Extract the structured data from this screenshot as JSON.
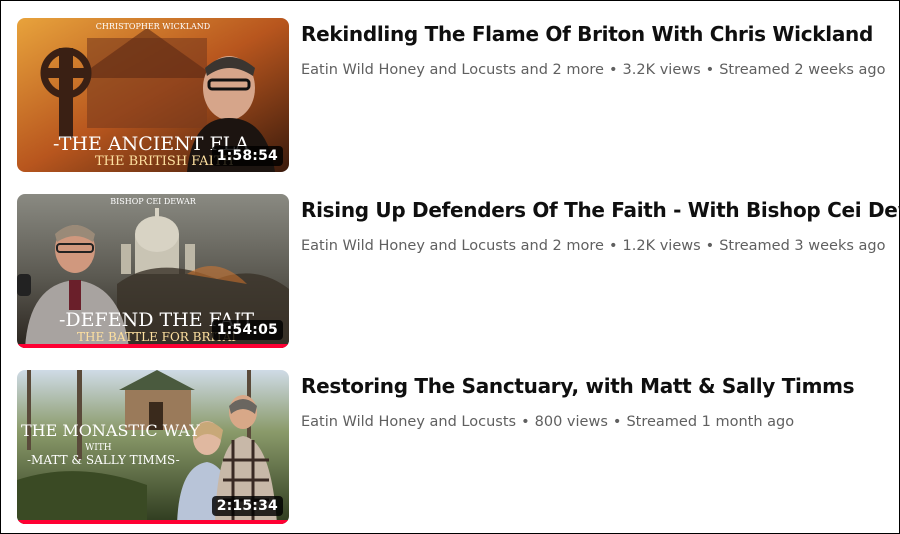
{
  "videos": [
    {
      "title": "Rekindling The Flame Of Briton With Chris Wickland",
      "channel": "Eatin Wild Honey and Locusts and 2 more",
      "views": "3.2K views",
      "streamed": "Streamed 2 weeks ago",
      "duration": "1:58:54",
      "thumb_top": "CHRISTOPHER WICKLAND",
      "thumb_main": "-THE ANCIENT FLA",
      "thumb_sub": "THE BRITISH FAITH",
      "progress": 0
    },
    {
      "title": "Rising Up Defenders Of The Faith - With Bishop Cei Dewar",
      "channel": "Eatin Wild Honey and Locusts and 2 more",
      "views": "1.2K views",
      "streamed": "Streamed 3 weeks ago",
      "duration": "1:54:05",
      "thumb_top": "BISHOP CEI DEWAR",
      "thumb_main": "-DEFEND THE FAIT",
      "thumb_sub": "THE BATTLE FOR BRITAI",
      "progress": 1.0
    },
    {
      "title": "Restoring The Sanctuary, with Matt & Sally Timms",
      "channel": "Eatin Wild Honey and Locusts",
      "views": "800 views",
      "streamed": "Streamed 1 month ago",
      "duration": "2:15:34",
      "thumb_main": "THE MONASTIC WAY",
      "thumb_with": "WITH",
      "thumb_sub": "-MATT & SALLY TIMMS-",
      "progress": 1.0
    }
  ],
  "colors": {
    "watched_bar": "#ff0033",
    "title": "#0f0f0f",
    "meta": "#606060"
  },
  "separator": "•"
}
